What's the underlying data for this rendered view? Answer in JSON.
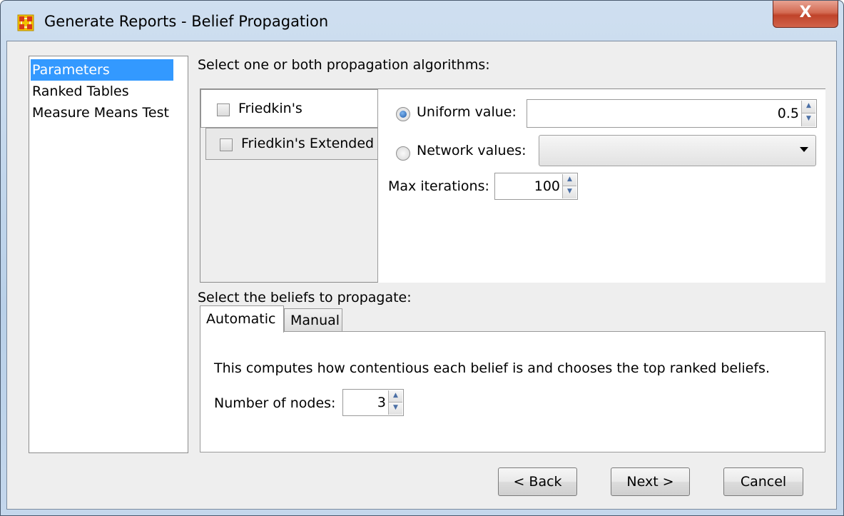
{
  "window": {
    "title": "Generate Reports - Belief Propagation",
    "close_glyph": "X"
  },
  "nav": {
    "items": [
      {
        "label": "Parameters",
        "selected": true
      },
      {
        "label": "Ranked Tables",
        "selected": false
      },
      {
        "label": "Measure Means Test",
        "selected": false
      }
    ]
  },
  "algorithms": {
    "heading": "Select one or both propagation algorithms:",
    "options": [
      {
        "label": "Friedkin's",
        "checked": false
      },
      {
        "label": "Friedkin's Extended",
        "checked": false
      }
    ],
    "uniform_label": "Uniform value:",
    "uniform_value": "0.5",
    "uniform_selected": true,
    "network_label": "Network values:",
    "network_value": "",
    "network_selected": false,
    "max_iterations_label": "Max iterations:",
    "max_iterations_value": "100"
  },
  "beliefs": {
    "heading": "Select the beliefs to propagate:",
    "tabs": [
      {
        "label": "Automatic",
        "active": true
      },
      {
        "label": "Manual",
        "active": false
      }
    ],
    "description": "This computes how contentious each belief is and chooses the top ranked beliefs.",
    "nodes_label": "Number of nodes:",
    "nodes_value": "3"
  },
  "buttons": {
    "back": "< Back",
    "next": "Next >",
    "cancel": "Cancel"
  },
  "colors": {
    "selection": "#3399ff",
    "close_button": "#c9553d",
    "window_frame": "#c4d7ec"
  }
}
